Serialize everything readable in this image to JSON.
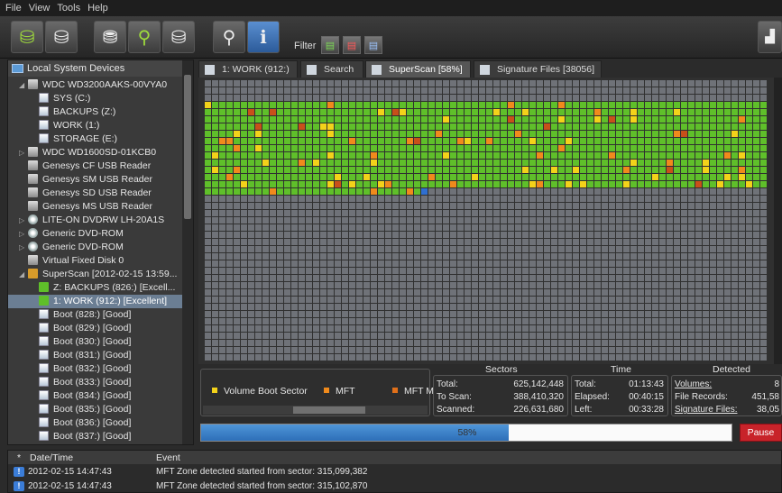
{
  "menu": [
    "File",
    "View",
    "Tools",
    "Help"
  ],
  "toolbar": {
    "buttons": [
      {
        "name": "scan-drive-icon"
      },
      {
        "name": "stop-icon"
      },
      {
        "name": "recover-icon"
      },
      {
        "name": "search-icon"
      },
      {
        "name": "disk-tools-icon"
      },
      {
        "name": "preview-icon"
      },
      {
        "name": "info-icon"
      }
    ],
    "filter_label": "Filter",
    "filters": [
      {
        "name": "filter-existing-icon"
      },
      {
        "name": "filter-deleted-icon"
      },
      {
        "name": "filter-all-icon"
      }
    ]
  },
  "tree": {
    "header": "Local System Devices",
    "rows": [
      {
        "indent": 1,
        "arrow": "◢",
        "icon": "disk",
        "label": "WDC WD3200AAKS-00VYA0"
      },
      {
        "indent": 3,
        "arrow": "",
        "icon": "vol",
        "label": "SYS (C:)"
      },
      {
        "indent": 3,
        "arrow": "",
        "icon": "vol",
        "label": "BACKUPS (Z:)"
      },
      {
        "indent": 3,
        "arrow": "",
        "icon": "vol",
        "label": "WORK (1:)"
      },
      {
        "indent": 3,
        "arrow": "",
        "icon": "vol",
        "label": "STORAGE (E:)"
      },
      {
        "indent": 1,
        "arrow": "▷",
        "icon": "disk",
        "label": "WDC WD1600SD-01KCB0"
      },
      {
        "indent": 1,
        "arrow": "",
        "icon": "disk",
        "label": "Genesys CF  USB Reader"
      },
      {
        "indent": 1,
        "arrow": "",
        "icon": "disk",
        "label": "Genesys SM  USB Reader"
      },
      {
        "indent": 1,
        "arrow": "",
        "icon": "disk",
        "label": "Genesys SD  USB Reader"
      },
      {
        "indent": 1,
        "arrow": "",
        "icon": "disk",
        "label": "Genesys MS  USB Reader"
      },
      {
        "indent": 1,
        "arrow": "▷",
        "icon": "cd",
        "label": "LITE-ON DVDRW LH-20A1S"
      },
      {
        "indent": 1,
        "arrow": "▷",
        "icon": "cd",
        "label": "Generic DVD-ROM"
      },
      {
        "indent": 1,
        "arrow": "▷",
        "icon": "cd",
        "label": "Generic DVD-ROM"
      },
      {
        "indent": 1,
        "arrow": "",
        "icon": "disk",
        "label": "Virtual Fixed Disk 0"
      },
      {
        "indent": 1,
        "arrow": "◢",
        "icon": "scan",
        "label": "SuperScan [2012-02-15 13:59..."
      },
      {
        "indent": 3,
        "arrow": "",
        "icon": "green",
        "label": "Z: BACKUPS (826:) [Excell..."
      },
      {
        "indent": 3,
        "arrow": "",
        "icon": "green",
        "label": "1: WORK (912:) [Excellent]",
        "selected": true
      },
      {
        "indent": 3,
        "arrow": "",
        "icon": "vol",
        "label": "Boot (828:) [Good]"
      },
      {
        "indent": 3,
        "arrow": "",
        "icon": "vol",
        "label": "Boot (829:) [Good]"
      },
      {
        "indent": 3,
        "arrow": "",
        "icon": "vol",
        "label": "Boot (830:) [Good]"
      },
      {
        "indent": 3,
        "arrow": "",
        "icon": "vol",
        "label": "Boot (831:) [Good]"
      },
      {
        "indent": 3,
        "arrow": "",
        "icon": "vol",
        "label": "Boot (832:) [Good]"
      },
      {
        "indent": 3,
        "arrow": "",
        "icon": "vol",
        "label": "Boot (833:) [Good]"
      },
      {
        "indent": 3,
        "arrow": "",
        "icon": "vol",
        "label": "Boot (834:) [Good]"
      },
      {
        "indent": 3,
        "arrow": "",
        "icon": "vol",
        "label": "Boot (835:) [Good]"
      },
      {
        "indent": 3,
        "arrow": "",
        "icon": "vol",
        "label": "Boot (836:) [Good]"
      },
      {
        "indent": 3,
        "arrow": "",
        "icon": "vol",
        "label": "Boot (837:) [Good]"
      }
    ]
  },
  "tabs": [
    {
      "label": "1: WORK (912:)",
      "active": false
    },
    {
      "label": "Search",
      "active": false
    },
    {
      "label": "SuperScan [58%]",
      "active": true
    },
    {
      "label": "Signature Files [38056]",
      "active": false
    }
  ],
  "legend": {
    "items": [
      {
        "label": "Volume Boot Sector",
        "color": "#f3d21a"
      },
      {
        "label": "MFT",
        "color": "#f08a1c"
      },
      {
        "label": "MFT M",
        "color": "#e0701a"
      }
    ]
  },
  "stats": {
    "sectors": {
      "title": "Sectors",
      "rows": [
        {
          "label": "Total:",
          "value": "625,142,448"
        },
        {
          "label": "To Scan:",
          "value": "388,410,320"
        },
        {
          "label": "Scanned:",
          "value": "226,631,680"
        }
      ]
    },
    "time": {
      "title": "Time",
      "rows": [
        {
          "label": "Total:",
          "value": "01:13:43"
        },
        {
          "label": "Elapsed:",
          "value": "00:40:15"
        },
        {
          "label": "Left:",
          "value": "00:33:28"
        }
      ]
    },
    "detected": {
      "title": "Detected",
      "rows": [
        {
          "label": "Volumes:",
          "value": "8"
        },
        {
          "label": "File Records:",
          "value": "451,58"
        },
        {
          "label": "Signature Files:",
          "value": "38,05"
        }
      ]
    }
  },
  "progress": {
    "text": "58%",
    "fraction": 0.58
  },
  "pause_label": "Pause",
  "log": {
    "col_star": "*",
    "col_date": "Date/Time",
    "col_event": "Event",
    "rows": [
      {
        "date": "2012-02-15 14:47:43",
        "event": "MFT Zone detected started from sector: 315,099,382"
      },
      {
        "date": "2012-02-15 14:47:43",
        "event": "MFT Zone detected started from sector: 315,102,870"
      }
    ]
  },
  "colors": {
    "scanned": "#5fbf2a",
    "unscanned": "#6f7278",
    "boot_sector": "#f3d21a",
    "mft": "#f08a1c",
    "mft_mirror": "#c8501a",
    "cursor": "#2f6fd0"
  }
}
